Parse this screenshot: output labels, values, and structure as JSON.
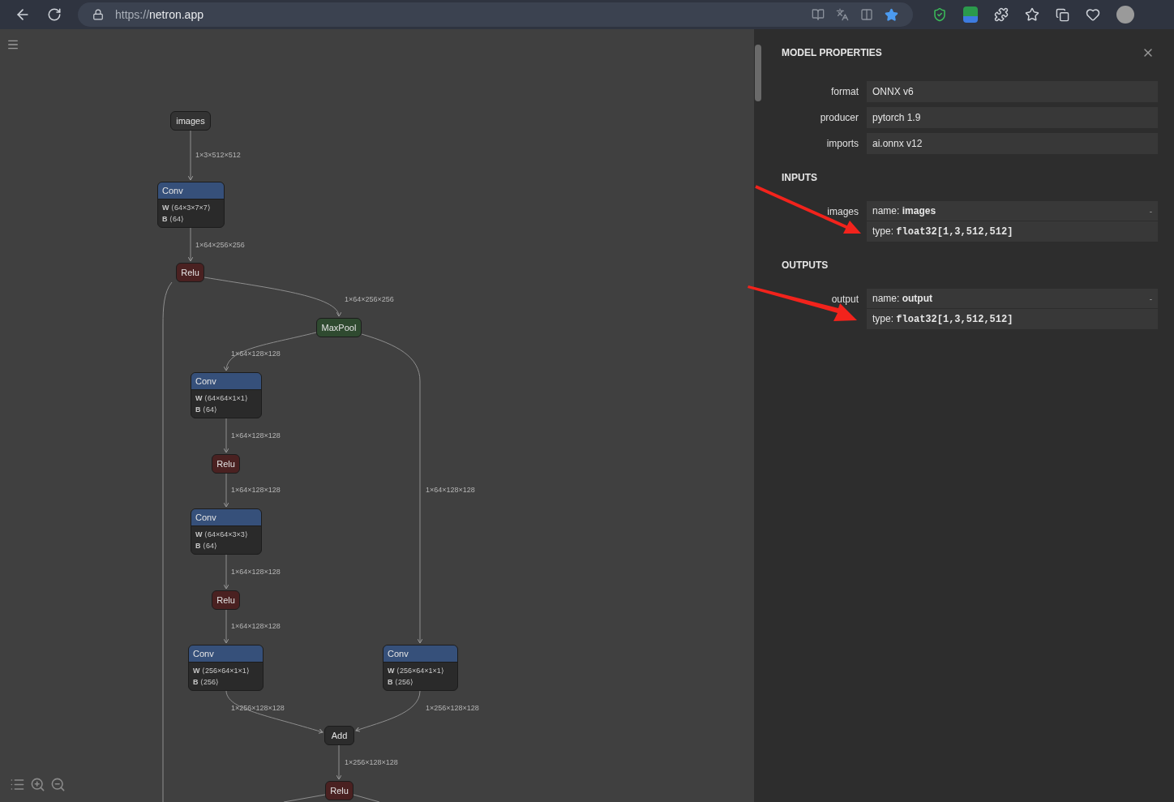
{
  "browser": {
    "scheme": "https://",
    "host": "netron.app"
  },
  "graph": {
    "nodes": [
      {
        "kind": "input",
        "title": "images"
      },
      {
        "kind": "conv",
        "title": "Conv",
        "attrs": [
          {
            "key": "W",
            "value": "⟨64×3×7×7⟩"
          },
          {
            "key": "B",
            "value": "⟨64⟩"
          }
        ]
      },
      {
        "kind": "relu",
        "title": "Relu"
      },
      {
        "kind": "maxpool",
        "title": "MaxPool"
      },
      {
        "kind": "conv",
        "title": "Conv",
        "attrs": [
          {
            "key": "W",
            "value": "⟨64×64×1×1⟩"
          },
          {
            "key": "B",
            "value": "⟨64⟩"
          }
        ]
      },
      {
        "kind": "relu",
        "title": "Relu"
      },
      {
        "kind": "conv",
        "title": "Conv",
        "attrs": [
          {
            "key": "W",
            "value": "⟨64×64×3×3⟩"
          },
          {
            "key": "B",
            "value": "⟨64⟩"
          }
        ]
      },
      {
        "kind": "relu",
        "title": "Relu"
      },
      {
        "kind": "conv",
        "title": "Conv",
        "attrs": [
          {
            "key": "W",
            "value": "⟨256×64×1×1⟩"
          },
          {
            "key": "B",
            "value": "⟨256⟩"
          }
        ]
      },
      {
        "kind": "conv",
        "title": "Conv",
        "attrs": [
          {
            "key": "W",
            "value": "⟨256×64×1×1⟩"
          },
          {
            "key": "B",
            "value": "⟨256⟩"
          }
        ]
      },
      {
        "kind": "add",
        "title": "Add"
      },
      {
        "kind": "relu",
        "title": "Relu"
      }
    ],
    "edge_labels": [
      "1×3×512×512",
      "1×64×256×256",
      "1×64×256×256",
      "1×64×128×128",
      "1×64×128×128",
      "1×64×128×128",
      "1×64×128×128",
      "1×64×128×128",
      "1×64×128×128",
      "1×256×128×128",
      "1×256×128×128",
      "1×256×128×128"
    ]
  },
  "properties": {
    "title": "MODEL PROPERTIES",
    "fields": [
      {
        "label": "format",
        "value": "ONNX v6"
      },
      {
        "label": "producer",
        "value": "pytorch 1.9"
      },
      {
        "label": "imports",
        "value": "ai.onnx v12"
      }
    ],
    "sections": [
      {
        "title": "INPUTS",
        "items": [
          {
            "label": "images",
            "name_key": "name:",
            "name": "images",
            "type_key": "type:",
            "type": "float32[1,3,512,512]",
            "toggle": "-"
          }
        ]
      },
      {
        "title": "OUTPUTS",
        "items": [
          {
            "label": "output",
            "name_key": "name:",
            "name": "output",
            "type_key": "type:",
            "type": "float32[1,3,512,512]",
            "toggle": "-"
          }
        ]
      }
    ]
  }
}
